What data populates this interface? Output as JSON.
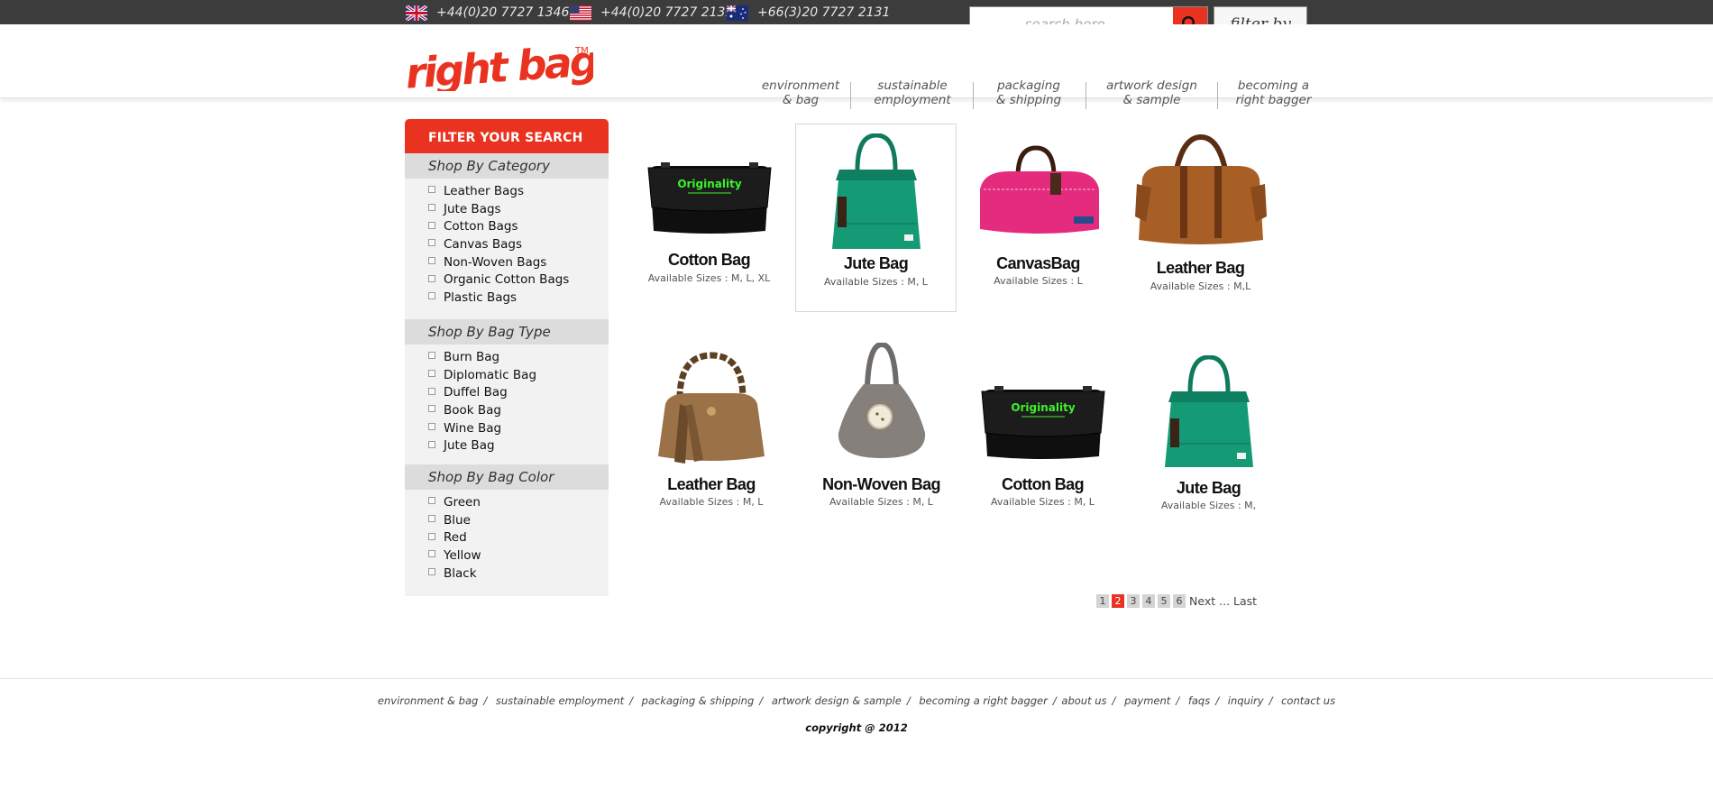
{
  "topbar": {
    "phones": [
      {
        "flag_icon": "uk-flag-icon",
        "number": "+44(0)20 7727 1346"
      },
      {
        "flag_icon": "us-flag-icon",
        "number": "+44(0)20 7727 2131"
      },
      {
        "flag_icon": "au-flag-icon",
        "number": "+66(3)20 7727 2131"
      }
    ],
    "search_placeholder": "search here . . .",
    "filter_label": "filter by"
  },
  "header": {
    "logo_text": "right bags",
    "logo_tm": "TM",
    "nav": [
      {
        "line1": "environment",
        "line2": "& bag"
      },
      {
        "line1": "sustainable",
        "line2": "employment"
      },
      {
        "line1": "packaging",
        "line2": "& shipping"
      },
      {
        "line1": "artwork design",
        "line2": "& sample"
      },
      {
        "line1": "becoming a",
        "line2": "right bagger"
      }
    ]
  },
  "sidebar": {
    "title": "FILTER YOUR SEARCH",
    "sections": [
      {
        "title": "Shop By Category",
        "items": [
          "Leather Bags",
          "Jute Bags",
          "Cotton Bags",
          "Canvas Bags",
          "Non-Woven Bags",
          "Organic Cotton Bags",
          "Plastic Bags"
        ]
      },
      {
        "title": "Shop By Bag Type",
        "items": [
          "Burn Bag",
          "Diplomatic Bag",
          "Duffel Bag",
          "Book Bag",
          "Wine Bag",
          "Jute Bag"
        ]
      },
      {
        "title": "Shop By Bag Color",
        "items": [
          "Green",
          "Blue",
          "Red",
          "Yellow",
          "Black"
        ]
      }
    ]
  },
  "products": [
    {
      "name": "Cotton Bag",
      "sizes": "Available Sizes : M, L, XL",
      "kind": "messenger-black",
      "print": "Originality"
    },
    {
      "name": "Jute Bag",
      "sizes": "Available Sizes : M, L",
      "kind": "tote-green",
      "selected": true
    },
    {
      "name": "CanvasBag",
      "sizes": "Available Sizes :  L",
      "kind": "duffel-pink"
    },
    {
      "name": "Leather Bag",
      "sizes": "Available Sizes :  M,L",
      "kind": "leather-brown"
    },
    {
      "name": "Leather Bag",
      "sizes": "Available Sizes : M, L",
      "kind": "handbag-tan"
    },
    {
      "name": "Non-Woven Bag",
      "sizes": "Available Sizes : M, L",
      "kind": "felt-grey"
    },
    {
      "name": "Cotton Bag",
      "sizes": "Available Sizes : M, L",
      "kind": "messenger-black",
      "print": "Originality"
    },
    {
      "name": "Jute Bag",
      "sizes": "Available Sizes : M,",
      "kind": "tote-green"
    }
  ],
  "pagination": {
    "pages": [
      "1",
      "2",
      "3",
      "4",
      "5",
      "6"
    ],
    "current": "2",
    "next_label": "Next",
    "ellipsis": "...",
    "last_label": "Last"
  },
  "footer": {
    "links": [
      "environment & bag",
      "sustainable employment",
      "packaging & shipping",
      "artwork design & sample",
      "becoming a right bagger",
      "about us",
      "payment",
      "faqs",
      "inquiry",
      "contact us"
    ],
    "copyright": "copyright @ 2012"
  },
  "colors": {
    "accent": "#e9321f",
    "topbar": "#3c3c3c",
    "sidebar_bg": "#f2f2f2",
    "section_bg": "#dcdcdc"
  }
}
